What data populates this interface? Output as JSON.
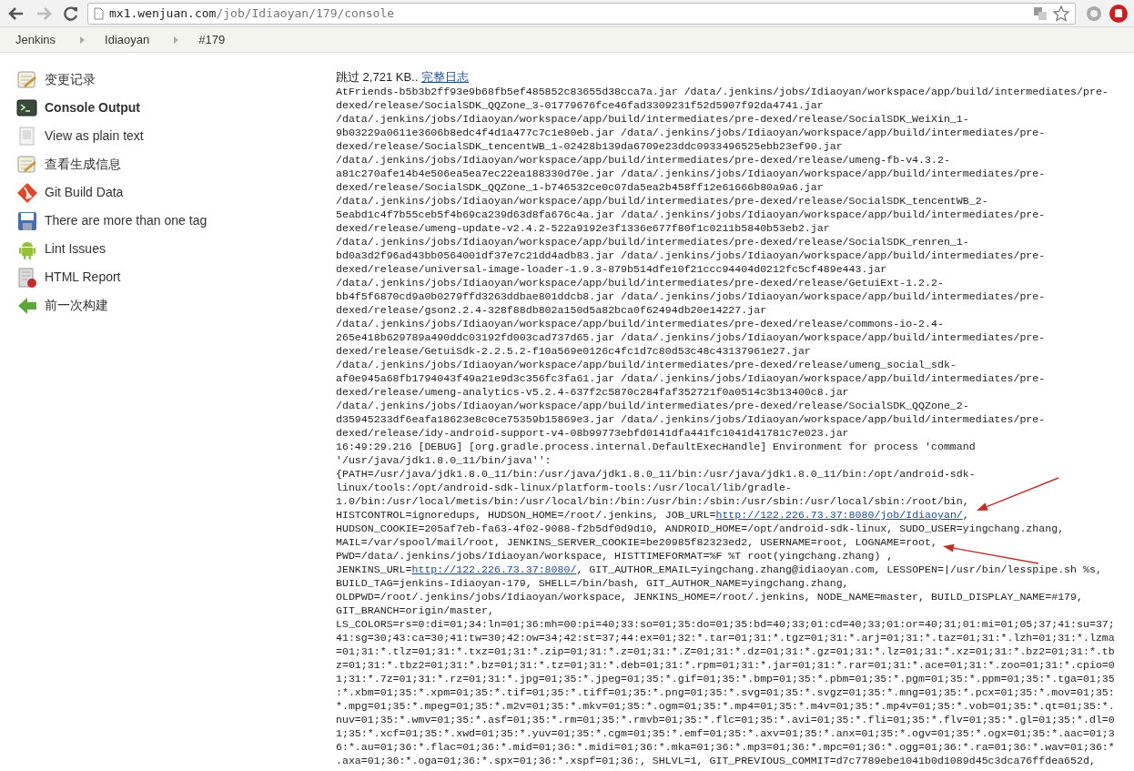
{
  "browser": {
    "url_host": "mx1.wenjuan.com",
    "url_path": "/job/Idiaoyan/179/console"
  },
  "breadcrumbs": [
    {
      "label": "Jenkins"
    },
    {
      "label": "Idiaoyan"
    },
    {
      "label": "#179"
    }
  ],
  "sidebar": {
    "items": [
      {
        "label": "变更记录",
        "selected": false
      },
      {
        "label": "Console Output",
        "selected": true
      },
      {
        "label": "View as plain text",
        "selected": false
      },
      {
        "label": "查看生成信息",
        "selected": false
      },
      {
        "label": "Git Build Data",
        "selected": false
      },
      {
        "label": "There are more than one tag",
        "selected": false
      },
      {
        "label": "Lint Issues",
        "selected": false
      },
      {
        "label": "HTML Report",
        "selected": false
      },
      {
        "label": "前一次构建",
        "selected": false
      }
    ]
  },
  "console": {
    "skipped": "跳过 2,721 KB.. ",
    "full_log_link": "完整日志",
    "lines": [
      {
        "text": "AtFriends-b5b3b2ff93e9b68fb5ef485852c83655d38cca7a.jar /data/.jenkins/jobs/Idiaoyan/workspace/app/build/intermediates/pre-"
      },
      {
        "text": "dexed/release/SocialSDK_QQZone_3-01779676fce46fad3309231f52d5907f92da4741.jar"
      },
      {
        "text": "/data/.jenkins/jobs/Idiaoyan/workspace/app/build/intermediates/pre-dexed/release/SocialSDK_WeiXin_1-"
      },
      {
        "text": "9b03229a0611e3606b8edc4f4d1a477c7c1e80eb.jar /data/.jenkins/jobs/Idiaoyan/workspace/app/build/intermediates/pre-"
      },
      {
        "text": "dexed/release/SocialSDK_tencentWB_1-02428b139da6709e23ddc0933496525ebb23ef90.jar"
      },
      {
        "text": "/data/.jenkins/jobs/Idiaoyan/workspace/app/build/intermediates/pre-dexed/release/umeng-fb-v4.3.2-"
      },
      {
        "text": "a81c270afe14b4e506ea5ea7ec22ea188330d70e.jar /data/.jenkins/jobs/Idiaoyan/workspace/app/build/intermediates/pre-"
      },
      {
        "text": "dexed/release/SocialSDK_QQZone_1-b746532ce0c07da5ea2b458ff12e61666b80a9a6.jar"
      },
      {
        "text": "/data/.jenkins/jobs/Idiaoyan/workspace/app/build/intermediates/pre-dexed/release/SocialSDK_tencentWB_2-"
      },
      {
        "text": "5eabd1c4f7b55ceb5f4b69ca239d63d8fa676c4a.jar /data/.jenkins/jobs/Idiaoyan/workspace/app/build/intermediates/pre-"
      },
      {
        "text": "dexed/release/umeng-update-v2.4.2-522a9192e3f1336e677f80f1c0211b5840b53eb2.jar"
      },
      {
        "text": "/data/.jenkins/jobs/Idiaoyan/workspace/app/build/intermediates/pre-dexed/release/SocialSDK_renren_1-"
      },
      {
        "text": "bd0a3d2f96ad43bb0564001df37e7c21dd4adb83.jar /data/.jenkins/jobs/Idiaoyan/workspace/app/build/intermediates/pre-"
      },
      {
        "text": "dexed/release/universal-image-loader-1.9.3-879b514dfe10f21ccc94404d0212fc5cf489e443.jar"
      },
      {
        "text": "/data/.jenkins/jobs/Idiaoyan/workspace/app/build/intermediates/pre-dexed/release/GetuiExt-1.2.2-"
      },
      {
        "text": "bb4f5f6870cd9a0b0279ffd3263ddbae801ddcb8.jar /data/.jenkins/jobs/Idiaoyan/workspace/app/build/intermediates/pre-"
      },
      {
        "text": "dexed/release/gson2.2.4-328f88db802a150d5a82bca0f62494db20e14227.jar"
      },
      {
        "text": "/data/.jenkins/jobs/Idiaoyan/workspace/app/build/intermediates/pre-dexed/release/commons-io-2.4-"
      },
      {
        "text": "265e418b629789a490ddc03192fd003cad737d65.jar /data/.jenkins/jobs/Idiaoyan/workspace/app/build/intermediates/pre-"
      },
      {
        "text": "dexed/release/GetuiSdk-2.2.5.2-f10a569e0126c4fc1d7c80d53c48c43137961e27.jar"
      },
      {
        "text": "/data/.jenkins/jobs/Idiaoyan/workspace/app/build/intermediates/pre-dexed/release/umeng_social_sdk-"
      },
      {
        "text": "af0e945a68fb1794043f49a21e9d3c356fc3fa61.jar /data/.jenkins/jobs/Idiaoyan/workspace/app/build/intermediates/pre-"
      },
      {
        "text": "dexed/release/umeng-analytics-v5.2.4-637f2c5870c284faf352721f0a0514c3b13400c8.jar"
      },
      {
        "text": "/data/.jenkins/jobs/Idiaoyan/workspace/app/build/intermediates/pre-dexed/release/SocialSDK_QQZone_2-"
      },
      {
        "text": "d35945233df6eafa18623e8c0ce75359b15869e3.jar /data/.jenkins/jobs/Idiaoyan/workspace/app/build/intermediates/pre-"
      },
      {
        "text": "dexed/release/idy-android-support-v4-08b99773ebfd0141dfa441fc1041d41781c7e023.jar"
      },
      {
        "text": "16:49:29.216 [DEBUG] [org.gradle.process.internal.DefaultExecHandle] Environment for process 'command"
      },
      {
        "text": "'/usr/java/jdk1.8.0_11/bin/java'':"
      },
      {
        "text": "{PATH=/usr/java/jdk1.8.0_11/bin:/usr/java/jdk1.8.0_11/bin:/usr/java/jdk1.8.0_11/bin:/opt/android-sdk-"
      },
      {
        "text": "linux/tools:/opt/android-sdk-linux/platform-tools:/usr/local/lib/gradle-"
      },
      {
        "text": "1.0/bin:/usr/local/metis/bin:/usr/local/bin:/bin:/usr/bin:/sbin:/usr/sbin:/usr/local/sbin:/root/bin,"
      },
      {
        "text": "HISTCONTROL=ignoredups, HUDSON_HOME=/root/.jenkins, JOB_URL=",
        "link": "http://122.226.73.37:8080/job/Idiaoyan/",
        "after": ","
      },
      {
        "text": "HUDSON_COOKIE=205af7eb-fa63-4f02-9088-f2b5df0d9d10, ANDROID_HOME=/opt/android-sdk-linux, SUDO_USER=yingchang.zhang,"
      },
      {
        "text": "MAIL=/var/spool/mail/root, JENKINS_SERVER_COOKIE=be20985f82323ed2, USERNAME=root, LOGNAME=root,"
      },
      {
        "text": "PWD=/data/.jenkins/jobs/Idiaoyan/workspace, HISTTIMEFORMAT=%F %T root(yingchang.zhang) ,"
      },
      {
        "text": "JENKINS_URL=",
        "link": "http://122.226.73.37:8080/",
        "after": ", GIT_AUTHOR_EMAIL=yingchang.zhang@idiaoyan.com, LESSOPEN=|/usr/bin/lesspipe.sh %s,"
      },
      {
        "text": "BUILD_TAG=jenkins-Idiaoyan-179, SHELL=/bin/bash, GIT_AUTHOR_NAME=yingchang.zhang,"
      },
      {
        "text": "OLDPWD=/root/.jenkins/jobs/Idiaoyan/workspace, JENKINS_HOME=/root/.jenkins, NODE_NAME=master, BUILD_DISPLAY_NAME=#179,"
      },
      {
        "text": "GIT_BRANCH=origin/master,"
      },
      {
        "text": "LS_COLORS=rs=0:di=01;34:ln=01;36:mh=00:pi=40;33:so=01;35:do=01;35:bd=40;33;01:cd=40;33;01:or=40;31;01:mi=01;05;37;41:su=37;"
      },
      {
        "text": "41:sg=30;43:ca=30;41:tw=30;42:ow=34;42:st=37;44:ex=01;32:*.tar=01;31:*.tgz=01;31:*.arj=01;31:*.taz=01;31:*.lzh=01;31:*.lzma"
      },
      {
        "text": "=01;31:*.tlz=01;31:*.txz=01;31:*.zip=01;31:*.z=01;31:*.Z=01;31:*.dz=01;31:*.gz=01;31:*.lz=01;31:*.xz=01;31:*.bz2=01;31:*.tb"
      },
      {
        "text": "z=01;31:*.tbz2=01;31:*.bz=01;31:*.tz=01;31:*.deb=01;31:*.rpm=01;31:*.jar=01;31:*.rar=01;31:*.ace=01;31:*.zoo=01;31:*.cpio=0"
      },
      {
        "text": "1;31:*.7z=01;31:*.rz=01;31:*.jpg=01;35:*.jpeg=01;35:*.gif=01;35:*.bmp=01;35:*.pbm=01;35:*.pgm=01;35:*.ppm=01;35:*.tga=01;35"
      },
      {
        "text": ":*.xbm=01;35:*.xpm=01;35:*.tif=01;35:*.tiff=01;35:*.png=01;35:*.svg=01;35:*.svgz=01;35:*.mng=01;35:*.pcx=01;35:*.mov=01;35:"
      },
      {
        "text": "*.mpg=01;35:*.mpeg=01;35:*.m2v=01;35:*.mkv=01;35:*.ogm=01;35:*.mp4=01;35:*.m4v=01;35:*.mp4v=01;35:*.vob=01;35:*.qt=01;35:*."
      },
      {
        "text": "nuv=01;35:*.wmv=01;35:*.asf=01;35:*.rm=01;35:*.rmvb=01;35:*.flc=01;35:*.avi=01;35:*.fli=01;35:*.flv=01;35:*.gl=01;35:*.dl=0"
      },
      {
        "text": "1;35:*.xcf=01;35:*.xwd=01;35:*.yuv=01;35:*.cgm=01;35:*.emf=01;35:*.axv=01;35:*.anx=01;35:*.ogv=01;35:*.ogx=01;35:*.aac=01;3"
      },
      {
        "text": "6:*.au=01;36:*.flac=01;36:*.mid=01;36:*.midi=01;36:*.mka=01;36:*.mp3=01;36:*.mpc=01;36:*.ogg=01;36:*.ra=01;36:*.wav=01;36:*"
      },
      {
        "text": ".axa=01;36:*.oga=01;36:*.spx=01;36:*.xspf=01;36:, SHLVL=1, GIT_PREVIOUS_COMMIT=d7c7789ebe1041b0d1089d45c3dca76ffdea652d,"
      }
    ]
  },
  "annotations": [
    {
      "kind": "arrow"
    },
    {
      "kind": "arrow"
    }
  ]
}
